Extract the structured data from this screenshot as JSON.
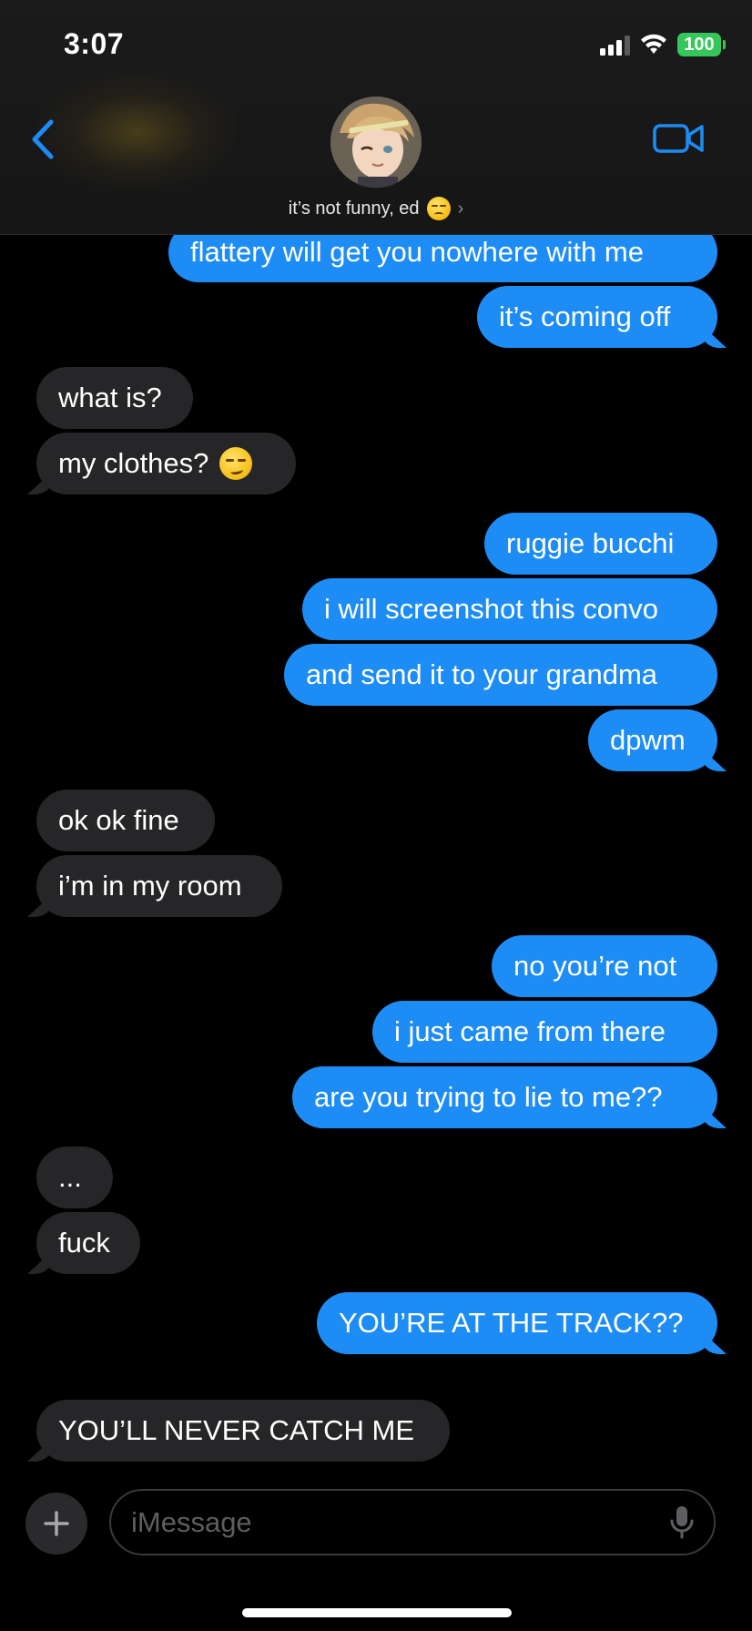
{
  "status_bar": {
    "time": "3:07",
    "battery": "100",
    "battery_color": "#35c759"
  },
  "header": {
    "contact_name": "it’s not funny, ed",
    "contact_emoji": "unamused-face-icon",
    "back_icon": "chevron-left-icon",
    "video_icon": "video-camera-icon",
    "accent_color": "#1e8cf5"
  },
  "messages": [
    {
      "side": "out",
      "text": "flattery will get you nowhere with me"
    },
    {
      "side": "out",
      "text": "it’s coming off"
    },
    {
      "side": "in",
      "text": "what is?"
    },
    {
      "side": "in",
      "text": "my clothes?",
      "emoji": "smirking-face-icon"
    },
    {
      "side": "out",
      "text": "ruggie bucchi"
    },
    {
      "side": "out",
      "text": "i will screenshot this convo"
    },
    {
      "side": "out",
      "text": "and send it to your grandma"
    },
    {
      "side": "out",
      "text": "dpwm"
    },
    {
      "side": "in",
      "text": "ok ok fine"
    },
    {
      "side": "in",
      "text": "i’m in my room"
    },
    {
      "side": "out",
      "text": "no you’re not"
    },
    {
      "side": "out",
      "text": "i just came from there"
    },
    {
      "side": "out",
      "text": "are you trying to lie to me??"
    },
    {
      "side": "in",
      "text": "..."
    },
    {
      "side": "in",
      "text": "fuck"
    },
    {
      "side": "out",
      "text": "YOU’RE AT THE TRACK??"
    },
    {
      "side": "in",
      "text": "YOU’LL NEVER CATCH ME"
    }
  ],
  "input": {
    "placeholder": "iMessage",
    "plus_icon": "plus-icon",
    "mic_icon": "microphone-icon"
  }
}
